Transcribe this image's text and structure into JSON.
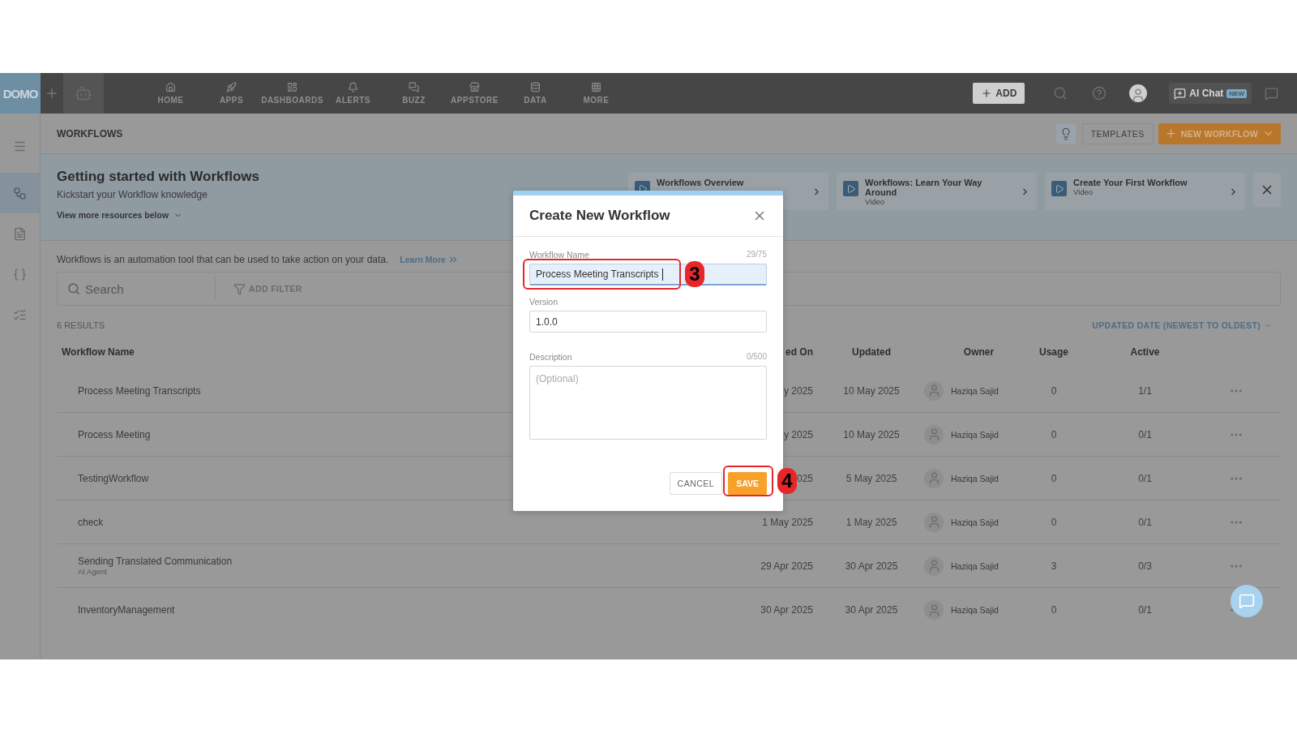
{
  "nav": {
    "logo": "DOMO",
    "items": [
      {
        "label": "HOME"
      },
      {
        "label": "APPS"
      },
      {
        "label": "DASHBOARDS"
      },
      {
        "label": "ALERTS"
      },
      {
        "label": "BUZZ"
      },
      {
        "label": "APPSTORE"
      },
      {
        "label": "DATA"
      },
      {
        "label": "MORE"
      }
    ],
    "add": "ADD",
    "ai_chat": "AI Chat",
    "ai_badge": "NEW"
  },
  "sidebar": {
    "items": [
      {
        "selected": true
      },
      {
        "selected": false
      },
      {
        "selected": false
      },
      {
        "selected": false
      }
    ]
  },
  "header": {
    "title": "WORKFLOWS",
    "templates": "TEMPLATES",
    "new_workflow": "NEW WORKFLOW"
  },
  "banner": {
    "title": "Getting started with Workflows",
    "subtitle": "Kickstart your Workflow knowledge",
    "more": "View more resources below",
    "resources": [
      {
        "title": "Workflows Overview"
      },
      {
        "title": "Workflows: Learn Your Way Around",
        "type": "Video"
      },
      {
        "title": "Create Your First Workflow",
        "type": "Video"
      }
    ]
  },
  "intro": {
    "text": "Workflows is an automation tool that can be used to take action on your data.",
    "link": "Learn More"
  },
  "search": {
    "placeholder": "Search",
    "filter": "ADD FILTER"
  },
  "results": "6 RESULTS",
  "sort": "UPDATED DATE (NEWEST TO OLDEST)",
  "table": {
    "columns": [
      "Workflow Name",
      "ed On",
      "Updated",
      "Owner",
      "Usage",
      "Active"
    ],
    "rows": [
      {
        "name": "Process Meeting Transcripts",
        "created": "y 2025",
        "updated": "10 May 2025",
        "owner": "Haziqa Sajid",
        "usage": "0",
        "active": "1/1"
      },
      {
        "name": "Process Meeting",
        "created": "y 2025",
        "updated": "10 May 2025",
        "owner": "Haziqa Sajid",
        "usage": "0",
        "active": "0/1"
      },
      {
        "name": "TestingWorkflow",
        "created": "025",
        "updated": "5 May 2025",
        "owner": "Haziqa Sajid",
        "usage": "0",
        "active": "0/1"
      },
      {
        "name": "check",
        "created": "1 May 2025",
        "updated": "1 May 2025",
        "owner": "Haziqa Sajid",
        "usage": "0",
        "active": "0/1"
      },
      {
        "name": "Sending Translated Communication",
        "subtitle": "AI Agent",
        "created": "29 Apr 2025",
        "updated": "30 Apr 2025",
        "owner": "Haziqa Sajid",
        "usage": "3",
        "active": "0/3"
      },
      {
        "name": "InventoryManagement",
        "created": "30 Apr 2025",
        "updated": "30 Apr 2025",
        "owner": "Haziqa Sajid",
        "usage": "0",
        "active": "0/1"
      }
    ]
  },
  "dialog": {
    "title": "Create New Workflow",
    "name": {
      "label": "Workflow Name",
      "counter": "29/75",
      "value": "Process Meeting Transcripts ",
      "focused": true
    },
    "version": {
      "label": "Version",
      "value": "1.0.0"
    },
    "description": {
      "label": "Description",
      "counter": "0/500",
      "placeholder": "(Optional)"
    },
    "cancel": "CANCEL",
    "save": "SAVE"
  },
  "annotations": [
    {
      "label": "3"
    },
    {
      "label": "4"
    }
  ]
}
